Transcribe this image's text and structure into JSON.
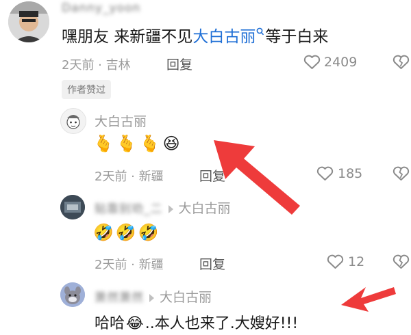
{
  "comments": [
    {
      "username": "Danny_yoon",
      "text_before": "嘿朋友 来新疆不见",
      "mention": "大白古丽",
      "text_after": "等于白来",
      "meta": "2天前 · 吉林",
      "reply_label": "回复",
      "likes": "2409",
      "author_tag": "作者赞过"
    },
    {
      "username": "大白古丽",
      "text_emojis": "🫰🫰🫰😆",
      "meta": "2天前 · 新疆",
      "reply_label": "回复",
      "likes": "185"
    },
    {
      "username": "贴靠别劝_二",
      "reply_to": "大白古丽",
      "text_emojis": "🤣🤣🤣",
      "meta": "2天前 · 新疆",
      "reply_label": "回复",
      "likes": "12"
    },
    {
      "username": "萧然萧然",
      "reply_to": "大白古丽",
      "text_before": "哈哈",
      "emoji": "😂",
      "text_after": "..本人也来了.大嫂好!!!"
    }
  ],
  "colors": {
    "mention": "#1f6fd6",
    "arrow": "#ee3b3b",
    "meta": "#9a9a9a"
  },
  "icons": [
    "heart-icon",
    "broken-heart-icon",
    "search-icon",
    "reply-arrow-icon"
  ]
}
